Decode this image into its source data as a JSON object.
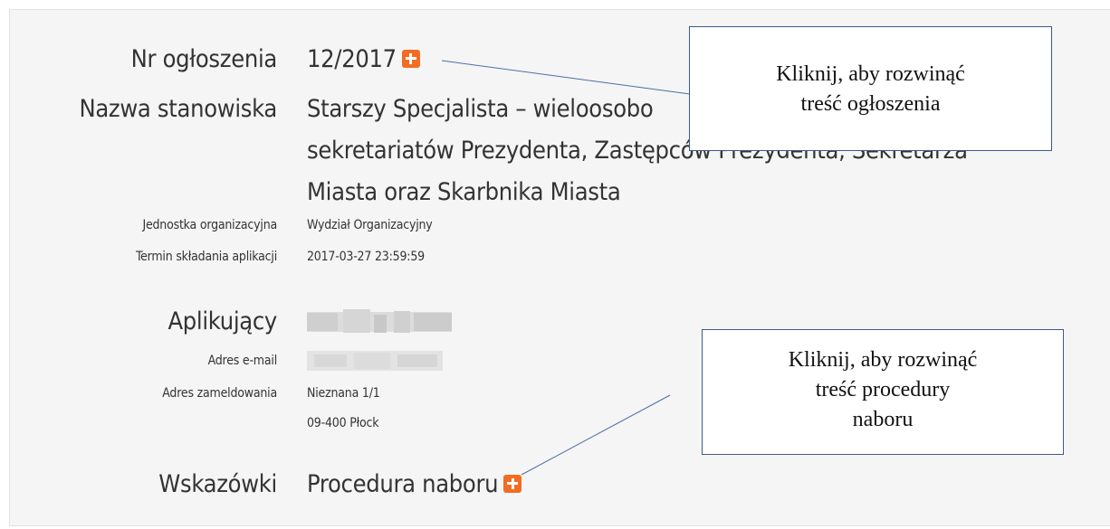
{
  "announcement": {
    "number_label": "Nr ogłoszenia",
    "number_value": "12/2017",
    "position_label": "Nazwa stanowiska",
    "position_line1": "Starszy Specjalista – wieloosobo",
    "position_line2": "sekretariatów Prezydenta, Zastępców Prezydenta, Sekretarza",
    "position_line3": "Miasta oraz Skarbnika Miasta",
    "unit_label": "Jednostka organizacyjna",
    "unit_value": "Wydział Organizacyjny",
    "deadline_label": "Termin składania aplikacji",
    "deadline_value": "2017-03-27 23:59:59"
  },
  "applicant": {
    "label": "Aplikujący",
    "email_label": "Adres e-mail",
    "address_label": "Adres zameldowania",
    "address_line1": "Nieznana 1/1",
    "address_line2": "09-400 Płock"
  },
  "hints": {
    "label": "Wskazówki",
    "procedure_link": "Procedura naboru"
  },
  "callouts": {
    "top_line1": "Kliknij, aby rozwinąć",
    "top_line2": "treść ogłoszenia",
    "bottom_line1": "Kliknij, aby rozwinąć",
    "bottom_line2": "treść procedury",
    "bottom_line3": "naboru"
  },
  "colors": {
    "accent": "#f26c22",
    "callout_border": "#3c5a8a",
    "panel_bg": "#f5f5f5"
  },
  "icons": {
    "expand": "plus-square-icon"
  }
}
